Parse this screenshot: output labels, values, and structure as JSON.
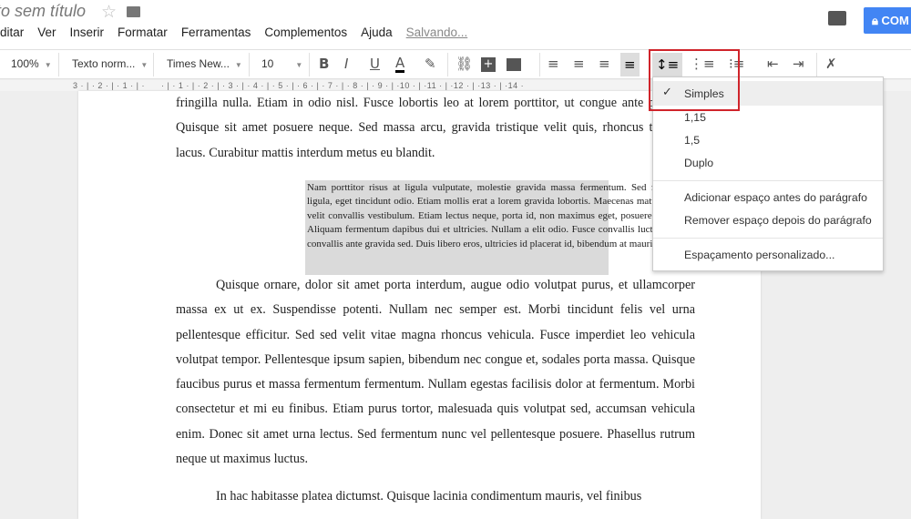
{
  "doc": {
    "title": "to sem título",
    "saving": "Salvando..."
  },
  "menu": [
    "ditar",
    "Ver",
    "Inserir",
    "Formatar",
    "Ferramentas",
    "Complementos",
    "Ajuda"
  ],
  "share": {
    "label": "COM",
    "color": "#4285f4"
  },
  "toolbar": {
    "zoom": "100%",
    "style": "Texto norm...",
    "font": "Times New...",
    "size": "10"
  },
  "ruler": "3 · | · 2 · | · 1 · | ·      · | · 1 · | · 2 · | · 3 · | · 4 · | · 5 · | · 6 · | · 7 · | · 8 · | · 9 · | ·10 · | ·11 · | ·12 · | ·13 · | ·14 ·",
  "body": {
    "p1": "fringilla nulla. Etiam in odio nisl. Fusce lobortis leo at lorem porttitor, ut congue ante purus, et Quisque sit amet posuere neque. Sed massa arcu, gravida tristique velit quis, rhoncus tincidunt lacus. Curabitur mattis interdum metus eu blandit.",
    "quote": "Nam porttitor risus at ligula vulputate, molestie gravida massa fermentum. Sed fermentum ligula, eget tincidunt odio. Etiam mollis erat a lorem gravida lobortis. Maecenas mattis elit non velit convallis vestibulum. Etiam lectus neque, porta id, non maximus eget, posuere eu massa. Aliquam fermentum dapibus dui et ultricies. Nullam a elit odio. Fusce convallis luctus eros, ut convallis ante gravida sed. Duis libero eros, ultricies id placerat id, bibendum at mauris.",
    "p2": "Quisque ornare, dolor sit amet porta interdum, augue odio volutpat purus, et ullamcorper massa ex ut ex. Suspendisse potenti. Nullam nec semper est. Morbi tincidunt felis vel urna pellentesque efficitur. Sed sed velit vitae magna rhoncus vehicula. Fusce imperdiet leo vehicula volutpat tempor. Pellentesque ipsum sapien, bibendum nec congue et, sodales porta massa. Quisque faucibus purus et massa fermentum fermentum. Nullam egestas facilisis dolor at fermentum. Morbi consectetur et mi eu finibus. Etiam purus tortor, malesuada quis volutpat sed, accumsan vehicula enim. Donec sit amet urna lectus. Sed fermentum nunc vel pellentesque posuere. Phasellus rutrum neque ut maximus luctus.",
    "p3": "In hac habitasse platea dictumst. Quisque lacinia condimentum mauris, vel finibus"
  },
  "spacing_menu": {
    "items": [
      "Simples",
      "1,15",
      "1,5",
      "Duplo"
    ],
    "selected": "Simples",
    "add_before": "Adicionar espaço antes do parágrafo",
    "remove_after": "Remover espaço depois do parágrafo",
    "custom": "Espaçamento personalizado..."
  },
  "highlight_color": "#d0242b"
}
